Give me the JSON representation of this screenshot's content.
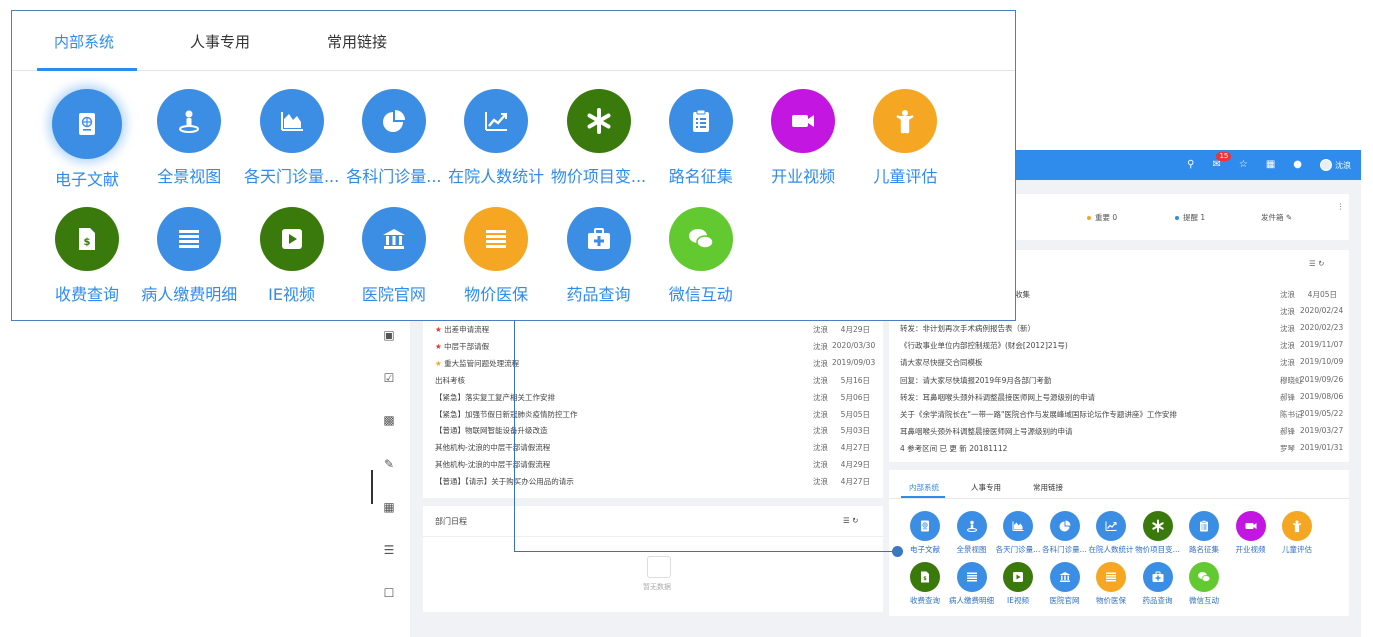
{
  "topbar": {
    "badge": "15",
    "user": "沈浪"
  },
  "mail": {
    "important": "重要 0",
    "remind": "提醒 1",
    "outbox": "发件箱"
  },
  "notices": [
    {
      "title": "收集",
      "who": "沈浪",
      "date": "4月05日"
    },
    {
      "title": "",
      "who": "沈浪",
      "date": "2020/02/24"
    },
    {
      "title": "转发：非计划再次手术病例报告表（新）",
      "who": "沈浪",
      "date": "2020/02/23"
    },
    {
      "title": "《行政事业单位内部控制规范》(财会[2012]21号)",
      "who": "沈浪",
      "date": "2019/11/07"
    },
    {
      "title": "请大家尽快提交合同模板",
      "who": "沈浪",
      "date": "2019/10/09"
    },
    {
      "title": "回复：请大家尽快填报2019年9月各部门考勤",
      "who": "穆晓虹",
      "date": "2019/09/26"
    },
    {
      "title": "转发：耳鼻咽喉头颈外科调整晨接医师网上号源级别的申请",
      "who": "郝锋",
      "date": "2019/08/06"
    },
    {
      "title": "关于《余学清院长在\"一带一路\"医院合作与发展峰域国际论坛作专题讲座》工作安排",
      "who": "陈书记",
      "date": "2019/05/22"
    },
    {
      "title": "耳鼻咽喉头颈外科调整晨接医师网上号源级别的申请",
      "who": "郝锋",
      "date": "2019/03/27"
    },
    {
      "title": "4 参考区间 已 更 新 20181112",
      "who": "罗琴",
      "date": "2019/01/31"
    }
  ],
  "flows": [
    {
      "title": "出差申请流程",
      "who": "沈浪",
      "date": "4月29日"
    },
    {
      "title": "中层干部请假",
      "who": "沈浪",
      "date": "2020/03/30"
    },
    {
      "title": "重大监管问题处理流程",
      "who": "沈浪",
      "date": "2019/09/03"
    },
    {
      "title": "出科考核",
      "who": "沈浪",
      "date": "5月16日"
    },
    {
      "title": "【紧急】落实复工复产相关工作安排",
      "who": "沈浪",
      "date": "5月06日"
    },
    {
      "title": "【紧急】加强节假日新冠肺炎疫情防控工作",
      "who": "沈浪",
      "date": "5月05日"
    },
    {
      "title": "【普通】物联网智能设备升级改造",
      "who": "沈浪",
      "date": "5月03日"
    },
    {
      "title": "其他机构-沈浪的中层干部请假流程",
      "who": "沈浪",
      "date": "4月27日"
    },
    {
      "title": "其他机构-沈浪的中层干部请假流程",
      "who": "沈浪",
      "date": "4月29日"
    },
    {
      "title": "【普通】【请示】关于购买办公用品的请示",
      "who": "沈浪",
      "date": "4月27日"
    }
  ],
  "schedule": {
    "title": "部门日程",
    "empty": "暂无数据"
  },
  "tabs": [
    "内部系统",
    "人事专用",
    "常用链接"
  ],
  "apps": [
    {
      "label": "电子文献",
      "icon": "passport-icon",
      "color": "#3c8ee4"
    },
    {
      "label": "全景视图",
      "icon": "user-location-icon",
      "color": "#3c8ee4"
    },
    {
      "label": "各天门诊量...",
      "icon": "area-chart-icon",
      "color": "#3c8ee4"
    },
    {
      "label": "各科门诊量...",
      "icon": "pie-chart-icon",
      "color": "#3c8ee4"
    },
    {
      "label": "在院人数统计",
      "icon": "line-chart-icon",
      "color": "#3c8ee4"
    },
    {
      "label": "物价项目变...",
      "icon": "asterisk-icon",
      "color": "#3a7a0c"
    },
    {
      "label": "路名征集",
      "icon": "clipboard-icon",
      "color": "#3c8ee4"
    },
    {
      "label": "开业视频",
      "icon": "video-icon",
      "color": "#c316e0"
    },
    {
      "label": "儿童评估",
      "icon": "child-icon",
      "color": "#f5a623"
    },
    {
      "label": "收费查询",
      "icon": "invoice-icon",
      "color": "#3a7a0c"
    },
    {
      "label": "病人缴费明细",
      "icon": "list-icon",
      "color": "#3c8ee4"
    },
    {
      "label": "IE视频",
      "icon": "play-icon",
      "color": "#3a7a0c"
    },
    {
      "label": "医院官网",
      "icon": "bank-icon",
      "color": "#3c8ee4"
    },
    {
      "label": "物价医保",
      "icon": "list-icon",
      "color": "#f5a623"
    },
    {
      "label": "药品查询",
      "icon": "medkit-icon",
      "color": "#3c8ee4"
    },
    {
      "label": "微信互动",
      "icon": "chat-icon",
      "color": "#63c931"
    }
  ],
  "mini_apps": [
    "电子文献",
    "全景视图",
    "各天门诊量...",
    "各科门诊量...",
    "在院人数统计",
    "物价项目变...",
    "路名征集",
    "开业视频",
    "儿童评估",
    "收费查询",
    "病人缴费明细",
    "IE视频",
    "医院官网",
    "物价医保",
    "药品查询",
    "微信互动"
  ]
}
